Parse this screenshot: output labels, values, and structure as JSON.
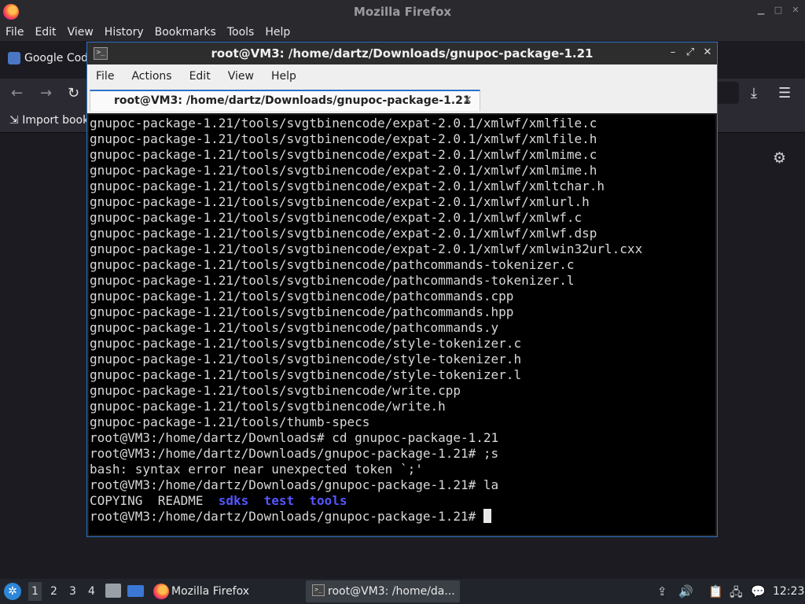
{
  "firefox": {
    "title": "Mozilla Firefox",
    "menu": [
      "File",
      "Edit",
      "View",
      "History",
      "Bookmarks",
      "Tools",
      "Help"
    ],
    "tab_label": "Google Cod",
    "bookmark_label": "Import book",
    "nav_icons": [
      "back-icon",
      "forward-icon",
      "reload-icon",
      "download-icon",
      "menu-icon",
      "gear-icon"
    ]
  },
  "terminal": {
    "title": "root@VM3: /home/dartz/Downloads/gnupoc-package-1.21",
    "menu": [
      "File",
      "Actions",
      "Edit",
      "View",
      "Help"
    ],
    "tab_title": "root@VM3: /home/dartz/Downloads/gnupoc-package-1.21",
    "lines": [
      "gnupoc-package-1.21/tools/svgtbinencode/expat-2.0.1/xmlwf/xmlfile.c",
      "gnupoc-package-1.21/tools/svgtbinencode/expat-2.0.1/xmlwf/xmlfile.h",
      "gnupoc-package-1.21/tools/svgtbinencode/expat-2.0.1/xmlwf/xmlmime.c",
      "gnupoc-package-1.21/tools/svgtbinencode/expat-2.0.1/xmlwf/xmlmime.h",
      "gnupoc-package-1.21/tools/svgtbinencode/expat-2.0.1/xmlwf/xmltchar.h",
      "gnupoc-package-1.21/tools/svgtbinencode/expat-2.0.1/xmlwf/xmlurl.h",
      "gnupoc-package-1.21/tools/svgtbinencode/expat-2.0.1/xmlwf/xmlwf.c",
      "gnupoc-package-1.21/tools/svgtbinencode/expat-2.0.1/xmlwf/xmlwf.dsp",
      "gnupoc-package-1.21/tools/svgtbinencode/expat-2.0.1/xmlwf/xmlwin32url.cxx",
      "gnupoc-package-1.21/tools/svgtbinencode/pathcommands-tokenizer.c",
      "gnupoc-package-1.21/tools/svgtbinencode/pathcommands-tokenizer.l",
      "gnupoc-package-1.21/tools/svgtbinencode/pathcommands.cpp",
      "gnupoc-package-1.21/tools/svgtbinencode/pathcommands.hpp",
      "gnupoc-package-1.21/tools/svgtbinencode/pathcommands.y",
      "gnupoc-package-1.21/tools/svgtbinencode/style-tokenizer.c",
      "gnupoc-package-1.21/tools/svgtbinencode/style-tokenizer.h",
      "gnupoc-package-1.21/tools/svgtbinencode/style-tokenizer.l",
      "gnupoc-package-1.21/tools/svgtbinencode/write.cpp",
      "gnupoc-package-1.21/tools/svgtbinencode/write.h",
      "gnupoc-package-1.21/tools/thumb-specs",
      "root@VM3:/home/dartz/Downloads# cd gnupoc-package-1.21",
      "root@VM3:/home/dartz/Downloads/gnupoc-package-1.21# ;s",
      "bash: syntax error near unexpected token `;'",
      "root@VM3:/home/dartz/Downloads/gnupoc-package-1.21# la"
    ],
    "ls_files": [
      "COPYING",
      "README"
    ],
    "ls_dirs": [
      "sdks",
      "test",
      "tools"
    ],
    "prompt": "root@VM3:/home/dartz/Downloads/gnupoc-package-1.21# "
  },
  "taskbar": {
    "workspaces": [
      "1",
      "2",
      "3",
      "4"
    ],
    "firefox_label": "Mozilla Firefox",
    "terminal_label": "root@VM3: /home/da...",
    "clock": "12:23"
  },
  "colors": {
    "accent": "#2c72c7",
    "ls_dir": "#5555ff",
    "terminal_bg": "#000000"
  }
}
